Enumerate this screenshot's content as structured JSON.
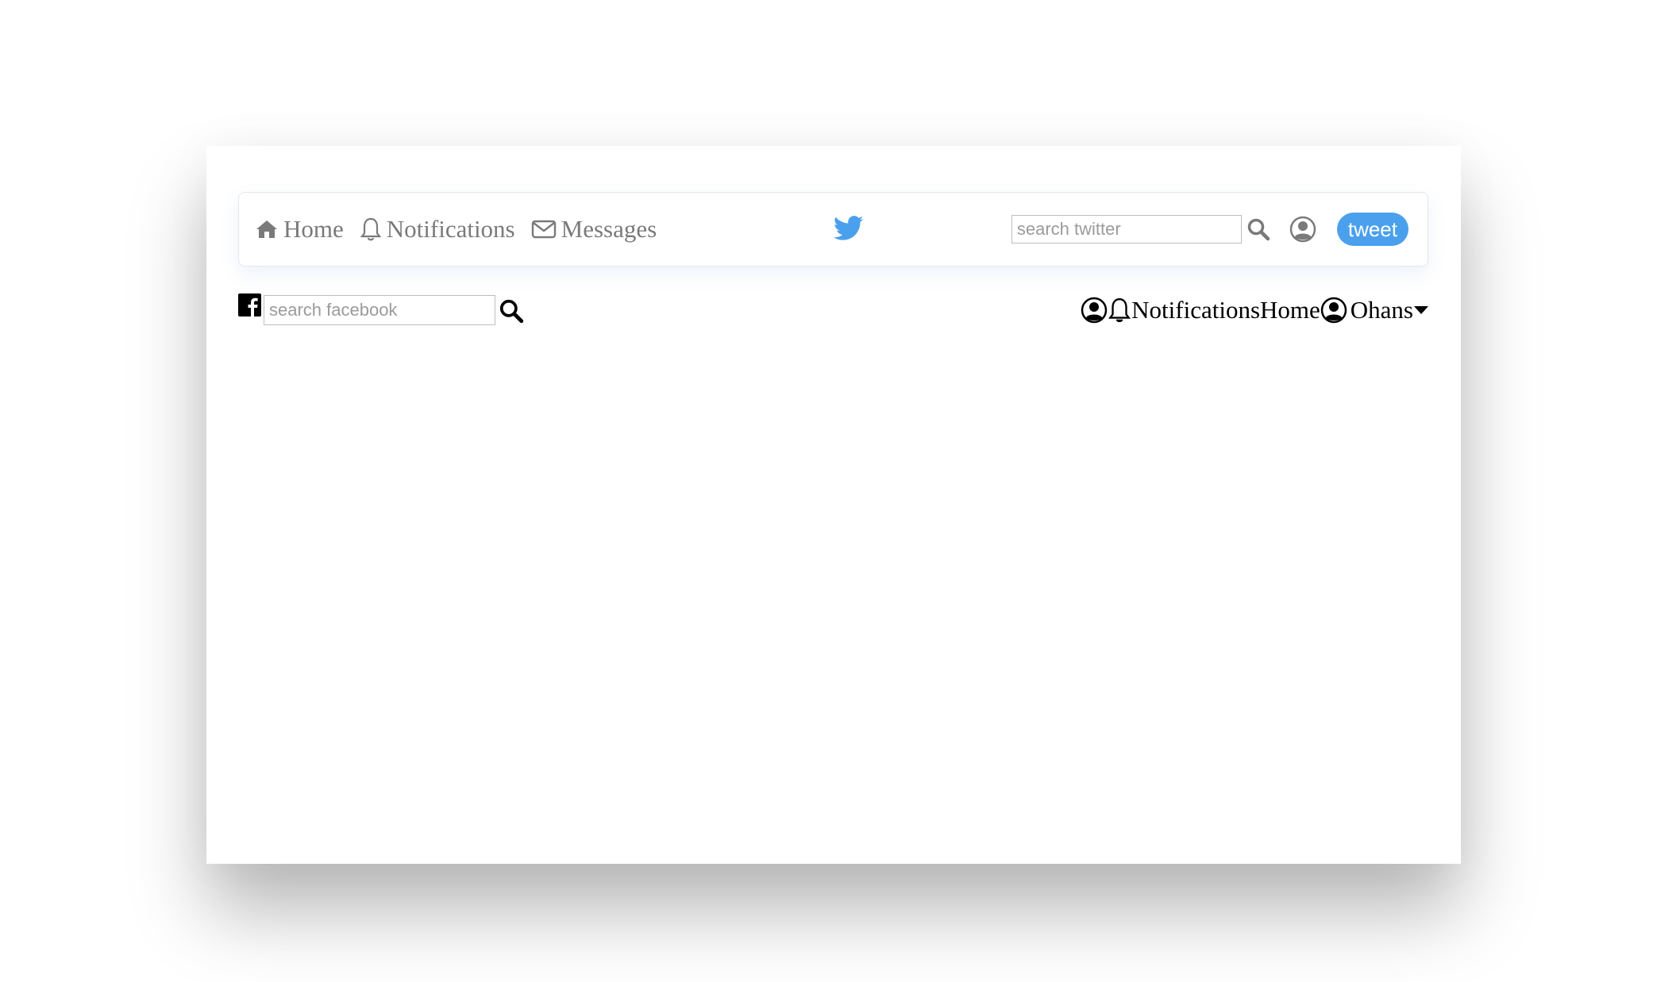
{
  "twitter_header": {
    "nav": [
      {
        "label": "Home",
        "icon": "home-icon"
      },
      {
        "label": "Notifications",
        "icon": "bell-icon"
      },
      {
        "label": "Messages",
        "icon": "envelope-icon"
      }
    ],
    "logo": "twitter-bird-icon",
    "search": {
      "placeholder": "search twitter",
      "value": ""
    },
    "tweet_label": "tweet",
    "colors": {
      "accent": "#4aa0ec",
      "nav_text": "#7a7a7a"
    }
  },
  "facebook_bar": {
    "search": {
      "placeholder": "search facebook",
      "value": ""
    },
    "notifications_label": "Notifications",
    "home_label": "Home",
    "user_name": "Ohans"
  }
}
